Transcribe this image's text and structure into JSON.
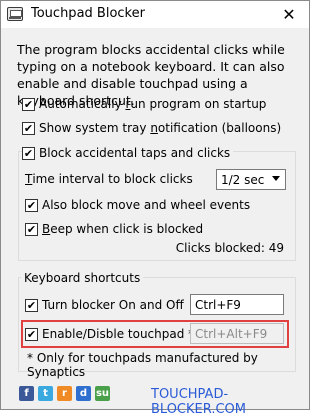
{
  "window": {
    "title": "Touchpad Blocker",
    "close_glyph": "✕"
  },
  "intro_text": "The program blocks accidental clicks while typing on a notebook keyboard. It can also enable and disable touchpad using a keyboard shortcut.",
  "options": {
    "autorun": {
      "pre": "Automatically ",
      "accel": "r",
      "post": "un program on startup",
      "checked": true
    },
    "tray": {
      "pre": "Show system tray ",
      "accel": "n",
      "post": "otification (balloons)",
      "checked": true
    },
    "block_taps": {
      "label": "Block accidental taps and clicks",
      "checked": true
    }
  },
  "interval": {
    "label_accel": "T",
    "label_rest": "ime interval to block clicks",
    "value": "1/2 sec"
  },
  "block_move": {
    "label": "Also block move and wheel events",
    "checked": true
  },
  "beep": {
    "accel": "B",
    "post": "eep when click is blocked",
    "checked": true
  },
  "clicks_blocked": "Clicks blocked: 49",
  "shortcuts": {
    "section_label": "Keyboard shortcuts",
    "turn_blocker": {
      "label": "Turn blocker On and Off",
      "value": "Ctrl+F9",
      "checked": true
    },
    "enable_touchpad": {
      "label": "Enable/Disble touchpad *",
      "value": "Ctrl+Alt+F9",
      "checked": true
    },
    "footnote": "* Only for touchpads manufactured by Synaptics"
  },
  "social": {
    "facebook": "f",
    "twitter": "t",
    "rss": "r",
    "delicious": "d",
    "stumbleupon": "su"
  },
  "footer_link": "TOUCHPAD-BLOCKER.COM",
  "colors": {
    "highlight": "#e04040",
    "link": "#2a5bd7"
  }
}
